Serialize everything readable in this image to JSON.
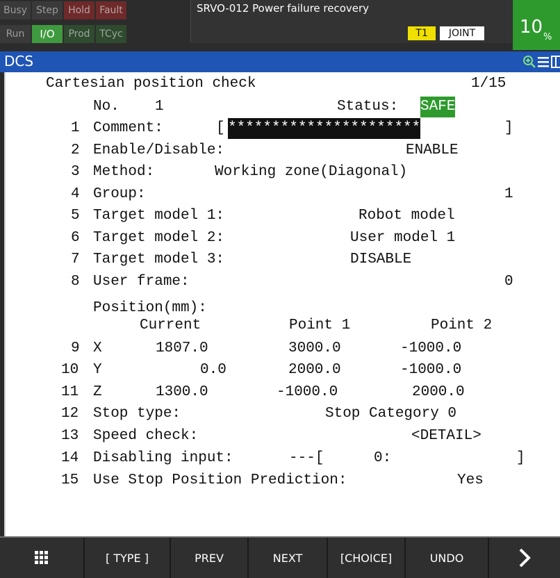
{
  "status_indicators": {
    "busy": "Busy",
    "step": "Step",
    "hold": "Hold",
    "fault": "Fault",
    "run": "Run",
    "io": "I/O",
    "prod": "Prod",
    "tcyc": "TCyc"
  },
  "alarm": {
    "message": "SRVO-012 Power failure recovery"
  },
  "mode": {
    "t1": "T1",
    "joint": "JOINT"
  },
  "override": {
    "value": "10",
    "unit": "%"
  },
  "title": "DCS",
  "screen": {
    "heading": "Cartesian position check",
    "page": "1/15",
    "no_label": "No.",
    "no_value": "1",
    "status_label": "Status:",
    "status_value": "SAFE",
    "items": {
      "comment": {
        "num": "1",
        "label": "Comment:",
        "open": "[",
        "value": "**********************",
        "close": "]"
      },
      "enable": {
        "num": "2",
        "label": "Enable/Disable:",
        "value": "ENABLE"
      },
      "method": {
        "num": "3",
        "label": "Method:",
        "value": "Working zone(Diagonal)"
      },
      "group": {
        "num": "4",
        "label": "Group:",
        "value": "1"
      },
      "target1": {
        "num": "5",
        "label": "Target model 1:",
        "value": "Robot model"
      },
      "target2": {
        "num": "6",
        "label": "Target model 2:",
        "value": "User model 1"
      },
      "target3": {
        "num": "7",
        "label": "Target model 3:",
        "value": "DISABLE"
      },
      "uframe": {
        "num": "8",
        "label": "User frame:",
        "value": "0"
      }
    },
    "position": {
      "label": "Position(mm):",
      "headers": [
        "Current",
        "Point 1",
        "Point 2"
      ],
      "rows": [
        {
          "num": "9",
          "axis": "X",
          "current": "1807.0",
          "p1": "3000.0",
          "p2": "-1000.0"
        },
        {
          "num": "10",
          "axis": "Y",
          "current": "0.0",
          "p1": "2000.0",
          "p2": "-1000.0"
        },
        {
          "num": "11",
          "axis": "Z",
          "current": "1300.0",
          "p1": "-1000.0",
          "p2": "2000.0"
        }
      ]
    },
    "items2": {
      "stoptype": {
        "num": "12",
        "label": "Stop type:",
        "value": "Stop Category 0"
      },
      "speed": {
        "num": "13",
        "label": "Speed check:",
        "value": "<DETAIL>"
      },
      "disabling": {
        "num": "14",
        "label": "Disabling input:",
        "type": "---[",
        "index": "0:",
        "close": "]"
      },
      "prediction": {
        "num": "15",
        "label": "Use Stop Position Prediction:",
        "value": "Yes"
      }
    }
  },
  "fkeys": [
    "[ TYPE ]",
    "PREV",
    "NEXT",
    "[CHOICE]",
    "UNDO"
  ],
  "icons": {
    "menu_grid": "grid-icon",
    "next_page": "chevron-right-icon",
    "zoom": "zoom-in-icon",
    "list": "hamburger-icon",
    "split": "split-window-icon"
  },
  "colors": {
    "title_bar": "#1f55b5",
    "safe": "#2e9a2e",
    "override": "#2e9a2e",
    "t1": "#f0e000",
    "io_active": "#3f9a3f"
  }
}
